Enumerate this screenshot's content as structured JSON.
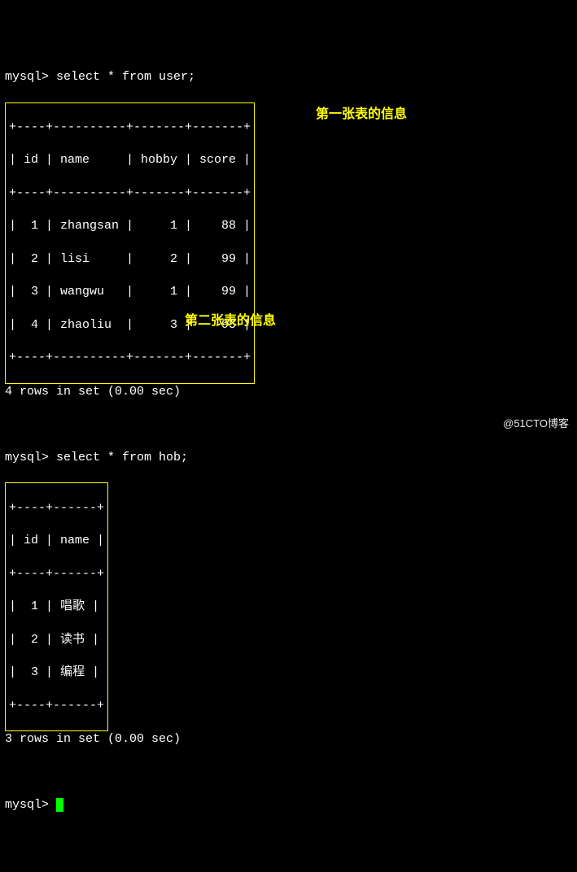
{
  "prompt1": "mysql> select * from user;",
  "table1": {
    "border_top": "+----+----------+-------+-------+",
    "header": "| id | name     | hobby | score |",
    "border_mid": "+----+----------+-------+-------+",
    "rows": [
      "|  1 | zhangsan |     1 |    88 |",
      "|  2 | lisi     |     2 |    99 |",
      "|  3 | wangwu   |     1 |    99 |",
      "|  4 | zhaoliu  |     3 |    95 |"
    ],
    "border_bot": "+----+----------+-------+-------+"
  },
  "result1": "4 rows in set (0.00 sec)",
  "prompt2": "mysql> select * from hob;",
  "table2": {
    "border_top": "+----+------+",
    "header": "| id | name |",
    "border_mid": "+----+------+",
    "rows": [
      "|  1 | 唱歌 |",
      "|  2 | 读书 |",
      "|  3 | 编程 |"
    ],
    "border_bot": "+----+------+"
  },
  "result2": "3 rows in set (0.00 sec)",
  "prompt3": "mysql> ",
  "annotation1": "第一张表的信息",
  "annotation2": "第二张表的信息",
  "watermark": "@51CTO博客",
  "chart_data": [
    {
      "type": "table",
      "title": "user",
      "columns": [
        "id",
        "name",
        "hobby",
        "score"
      ],
      "rows": [
        [
          1,
          "zhangsan",
          1,
          88
        ],
        [
          2,
          "lisi",
          2,
          99
        ],
        [
          3,
          "wangwu",
          1,
          99
        ],
        [
          4,
          "zhaoliu",
          3,
          95
        ]
      ]
    },
    {
      "type": "table",
      "title": "hob",
      "columns": [
        "id",
        "name"
      ],
      "rows": [
        [
          1,
          "唱歌"
        ],
        [
          2,
          "读书"
        ],
        [
          3,
          "编程"
        ]
      ]
    }
  ]
}
